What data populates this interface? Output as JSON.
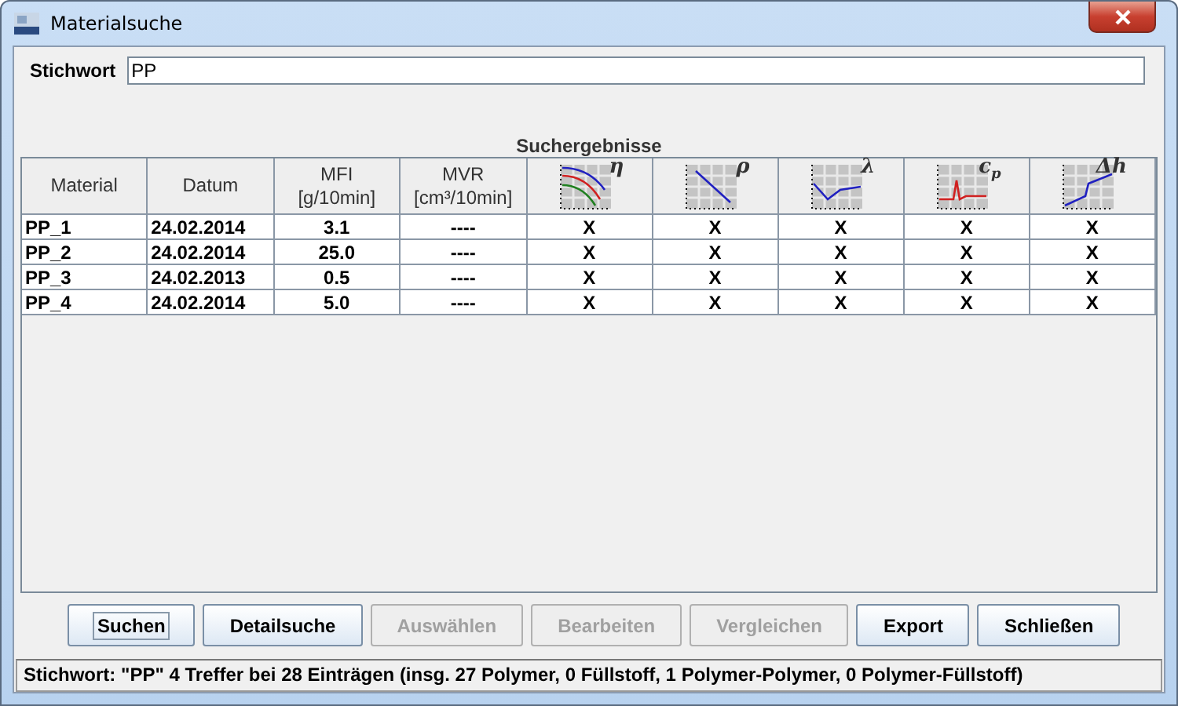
{
  "window": {
    "title": "Materialsuche"
  },
  "keyword": {
    "label": "Stichwort",
    "value": "PP"
  },
  "results": {
    "title": "Suchergebnisse",
    "columns": [
      {
        "kind": "text",
        "lines": [
          "Material"
        ]
      },
      {
        "kind": "text",
        "lines": [
          "Datum"
        ]
      },
      {
        "kind": "text",
        "lines": [
          "MFI",
          "[g/10min]"
        ]
      },
      {
        "kind": "text",
        "lines": [
          "MVR",
          "[cm³/10min]"
        ]
      },
      {
        "kind": "viscosity",
        "symbol": "η"
      },
      {
        "kind": "density",
        "symbol": "ρ"
      },
      {
        "kind": "conductivity",
        "symbol": "λ"
      },
      {
        "kind": "heat-capacity",
        "symbol": "c",
        "sub": "p"
      },
      {
        "kind": "enthalpy",
        "symbol": "Δh"
      }
    ],
    "rows": [
      {
        "cells": [
          "PP_1",
          "24.02.2014",
          "3.1",
          "----",
          "X",
          "X",
          "X",
          "X",
          "X"
        ]
      },
      {
        "cells": [
          "PP_2",
          "24.02.2014",
          "25.0",
          "----",
          "X",
          "X",
          "X",
          "X",
          "X"
        ]
      },
      {
        "cells": [
          "PP_3",
          "24.02.2013",
          "0.5",
          "----",
          "X",
          "X",
          "X",
          "X",
          "X"
        ]
      },
      {
        "cells": [
          "PP_4",
          "24.02.2014",
          "5.0",
          "----",
          "X",
          "X",
          "X",
          "X",
          "X"
        ]
      }
    ]
  },
  "buttons": [
    {
      "label": "Suchen",
      "disabled": false,
      "focused": true
    },
    {
      "label": "Detailsuche",
      "disabled": false,
      "focused": false
    },
    {
      "label": "Auswählen",
      "disabled": true,
      "focused": false
    },
    {
      "label": "Bearbeiten",
      "disabled": true,
      "focused": false
    },
    {
      "label": "Vergleichen",
      "disabled": true,
      "focused": false
    },
    {
      "label": "Export",
      "disabled": false,
      "focused": false
    },
    {
      "label": "Schließen",
      "disabled": false,
      "focused": false
    }
  ],
  "status_bar": "Stichwort: \"PP\" 4 Treffer bei 28 Einträgen (insg. 27 Polymer, 0 Füllstoff, 1 Polymer-Polymer, 0 Polymer-Füllstoff)"
}
